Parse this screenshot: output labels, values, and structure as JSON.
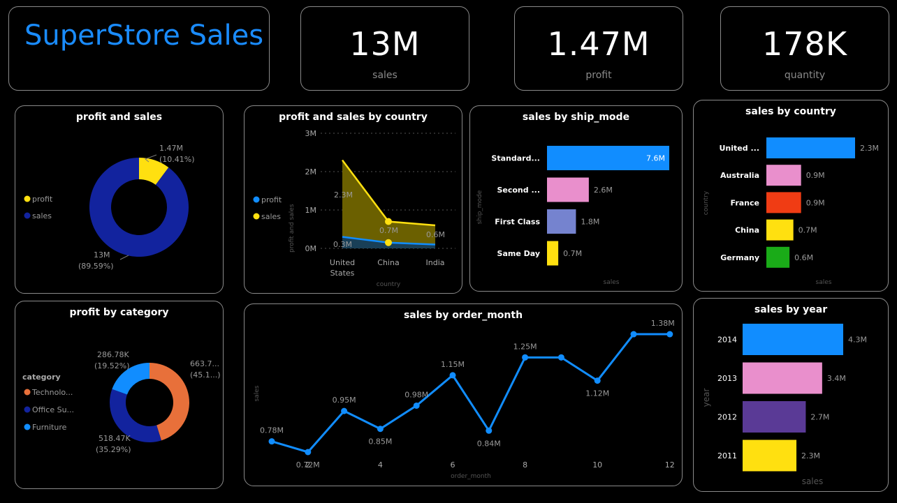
{
  "dashboard": {
    "title": "SuperStore Sales",
    "title_color": "#1a8cff",
    "kpis": [
      {
        "value": "13M",
        "label": "sales"
      },
      {
        "value": "1.47M",
        "label": "profit"
      },
      {
        "value": "178K",
        "label": "quantity"
      }
    ]
  },
  "colors": {
    "blue": "#118dff",
    "navy": "#12239e",
    "yellow": "#ffe010",
    "pink": "#e98fcc",
    "lavender": "#7583cf",
    "red": "#f03c14",
    "green": "#1aab18",
    "purple": "#5a3a96",
    "orange": "#e8703a"
  },
  "chart_data": [
    {
      "id": "profit_and_sales",
      "type": "pie",
      "title": "profit and sales",
      "legend": [
        "profit",
        "sales"
      ],
      "legend_placement": "left",
      "slices": [
        {
          "name": "profit",
          "value": 1.47,
          "label": "1.47M",
          "pct": "(10.41%)",
          "color": "#ffe010"
        },
        {
          "name": "sales",
          "value": 13,
          "label": "13M",
          "pct": "(89.59%)",
          "color": "#12239e"
        }
      ]
    },
    {
      "id": "profit_and_sales_by_country",
      "type": "area",
      "title": "profit and sales by country",
      "xlabel": "country",
      "ylabel": "profit and sales",
      "ylim": [
        0,
        3
      ],
      "yticks": [
        "0M",
        "1M",
        "2M",
        "3M"
      ],
      "categories": [
        "United States",
        "China",
        "India"
      ],
      "legend": [
        "profit",
        "sales"
      ],
      "series": [
        {
          "name": "sales",
          "values": [
            2.3,
            0.7,
            0.6
          ],
          "labels": [
            "2.3M",
            "0.7M",
            "0.6M"
          ],
          "color": "#ffe010"
        },
        {
          "name": "profit",
          "values": [
            0.3,
            0.15,
            0.1
          ],
          "labels": [
            "0.3M",
            "",
            ""
          ],
          "color": "#118dff"
        }
      ]
    },
    {
      "id": "sales_by_ship_mode",
      "type": "bar",
      "title": "sales by ship_mode",
      "xlabel": "sales",
      "ylabel": "ship_mode",
      "categories": [
        "Standard...",
        "Second ...",
        "First Class",
        "Same Day"
      ],
      "values": [
        7.6,
        2.6,
        1.8,
        0.7
      ],
      "labels": [
        "7.6M",
        "2.6M",
        "1.8M",
        "0.7M"
      ],
      "colors": [
        "#118dff",
        "#e98fcc",
        "#7583cf",
        "#ffe010"
      ]
    },
    {
      "id": "sales_by_country",
      "type": "bar",
      "title": "sales by country",
      "xlabel": "sales",
      "ylabel": "country",
      "categories": [
        "United ...",
        "Australia",
        "France",
        "China",
        "Germany"
      ],
      "values": [
        2.3,
        0.9,
        0.9,
        0.7,
        0.6
      ],
      "labels": [
        "2.3M",
        "0.9M",
        "0.9M",
        "0.7M",
        "0.6M"
      ],
      "colors": [
        "#118dff",
        "#e98fcc",
        "#f03c14",
        "#ffe010",
        "#1aab18"
      ]
    },
    {
      "id": "profit_by_category",
      "type": "pie",
      "title": "profit by category",
      "legend_title": "category",
      "legend": [
        "Technolo...",
        "Office Su...",
        "Furniture"
      ],
      "slices": [
        {
          "name": "Technolo...",
          "value": 663.7,
          "label": "663.7...",
          "pct": "(45.1...)",
          "color": "#e8703a"
        },
        {
          "name": "Office Su...",
          "value": 518.47,
          "label": "518.47K",
          "pct": "(35.29%)",
          "color": "#12239e"
        },
        {
          "name": "Furniture",
          "value": 286.78,
          "label": "286.78K",
          "pct": "(19.52%)",
          "color": "#118dff"
        }
      ]
    },
    {
      "id": "sales_by_order_month",
      "type": "line",
      "title": "sales by order_month",
      "xlabel": "order_month",
      "ylabel": "sales",
      "x": [
        1,
        2,
        3,
        4,
        5,
        6,
        7,
        8,
        9,
        10,
        11,
        12
      ],
      "xticks": [
        "2",
        "4",
        "6",
        "8",
        "10",
        "12"
      ],
      "values": [
        0.78,
        0.72,
        0.95,
        0.85,
        0.98,
        1.15,
        0.84,
        1.25,
        1.25,
        1.12,
        1.38,
        1.38
      ],
      "labels": [
        "0.78M",
        "0.72M",
        "0.95M",
        "0.85M",
        "0.98M",
        "1.15M",
        "0.84M",
        "1.25M",
        "",
        "1.12M",
        "",
        "1.38M"
      ],
      "color": "#118dff"
    },
    {
      "id": "sales_by_year",
      "type": "bar",
      "title": "sales by year",
      "xlabel": "sales",
      "ylabel": "year",
      "categories": [
        "2014",
        "2013",
        "2012",
        "2011"
      ],
      "values": [
        4.3,
        3.4,
        2.7,
        2.3
      ],
      "labels": [
        "4.3M",
        "3.4M",
        "2.7M",
        "2.3M"
      ],
      "colors": [
        "#118dff",
        "#e98fcc",
        "#5a3a96",
        "#ffe010"
      ]
    }
  ]
}
